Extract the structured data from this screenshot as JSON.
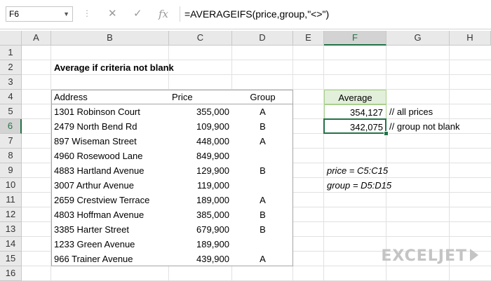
{
  "formula_bar": {
    "name_box": "F6",
    "cancel_glyph": "✕",
    "enter_glyph": "✓",
    "fx_glyph": "fx",
    "formula": "=AVERAGEIFS(price,group,\"<>\")"
  },
  "columns": [
    "A",
    "B",
    "C",
    "D",
    "E",
    "F",
    "G",
    "H"
  ],
  "rows": [
    "1",
    "2",
    "3",
    "4",
    "5",
    "6",
    "7",
    "8",
    "9",
    "10",
    "11",
    "12",
    "13",
    "14",
    "15",
    "16"
  ],
  "selected_cell": "F6",
  "title": "Average if criteria not blank",
  "table": {
    "headers": [
      "Address",
      "Price",
      "Group"
    ],
    "rows": [
      {
        "address": "1301 Robinson Court",
        "price": "355,000",
        "group": "A"
      },
      {
        "address": "2479 North Bend  Rd",
        "price": "109,900",
        "group": "B"
      },
      {
        "address": "897 Wiseman Street",
        "price": "448,000",
        "group": "A"
      },
      {
        "address": "4960 Rosewood Lane",
        "price": "849,900",
        "group": ""
      },
      {
        "address": "4883 Hartland Avenue",
        "price": "129,900",
        "group": "B"
      },
      {
        "address": "3007 Arthur Avenue",
        "price": "119,000",
        "group": ""
      },
      {
        "address": "2659 Crestview Terrace",
        "price": "189,000",
        "group": "A"
      },
      {
        "address": "4803 Hoffman Avenue",
        "price": "385,000",
        "group": "B"
      },
      {
        "address": "3385 Harter Street",
        "price": "679,900",
        "group": "B"
      },
      {
        "address": "1233 Green Avenue",
        "price": "189,900",
        "group": ""
      },
      {
        "address": "966 Trainer Avenue",
        "price": "439,900",
        "group": "A"
      }
    ]
  },
  "summary": {
    "header": "Average",
    "all_prices_value": "354,127",
    "all_prices_note": "// all prices",
    "not_blank_value": "342,075",
    "not_blank_note": "// group not blank"
  },
  "named_ranges": {
    "price": "price = C5:C15",
    "group": "group = D5:D15"
  },
  "logo": "EXCELJET",
  "colors": {
    "accent": "#217346",
    "header_fill": "#e2efda",
    "border_green": "#a9d08e",
    "grid": "#e1e1e1"
  }
}
